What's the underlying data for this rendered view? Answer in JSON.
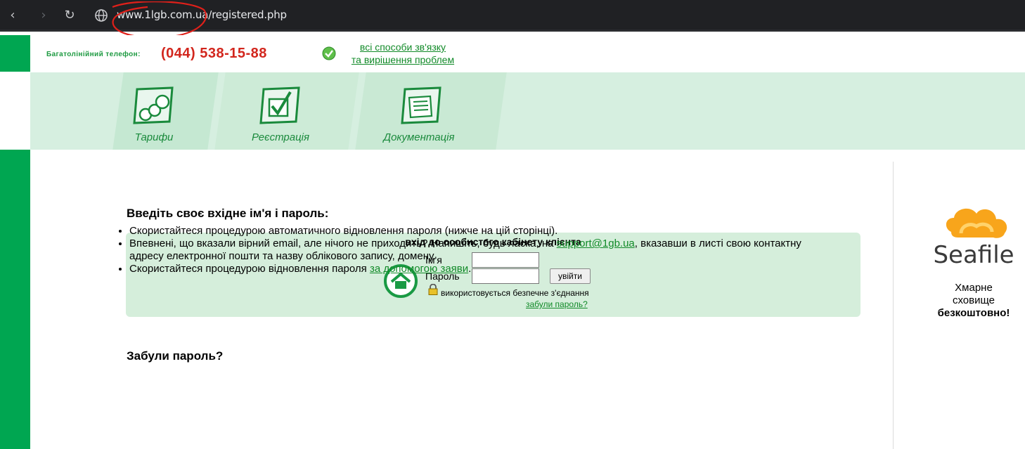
{
  "browser": {
    "url": "www.1lgb.com.ua/registered.php",
    "back_icon": "‹",
    "forward_icon": "›",
    "reload_icon": "↻"
  },
  "header": {
    "phone_label": "Багатолінійний телефон:",
    "phone_number": "(044) 538-15-88",
    "contact_line1": "всі способи зв'язку",
    "contact_line2": "та вирішення проблем"
  },
  "menu": {
    "items": [
      {
        "label": "Тарифи",
        "icon": "tariffs-coins-icon"
      },
      {
        "label": "Реєстрація",
        "icon": "registration-check-icon"
      },
      {
        "label": "Документація",
        "icon": "documentation-folder-icon"
      }
    ]
  },
  "login": {
    "title": "Введіть своє вхідне ім'я і пароль:",
    "box_title": "вхід до особистого кабінету клієнта",
    "name_label": "Ім'я",
    "password_label": "Пароль",
    "name_value": "",
    "password_value": "",
    "submit_label": "увійти",
    "secure_text": "використовується безпечне з'єднання",
    "forgot_link": "забули пароль?"
  },
  "forgot": {
    "title": "Забули пароль?",
    "tip1": "Скористайтеся процедурою автоматичного відновлення пароля (нижче на цій сторінці).",
    "tip2_before": "Впевнені, що вказали вірний email, але нічого не приходить? Напишіть, будь ласка, на ",
    "tip2_link": "support@1gb.ua",
    "tip2_after": ", вказавши в листі свою контактну адресу електронної пошти та назву облікового запису, домену.",
    "tip3_before": "Скористайтеся процедурою відновлення пароля ",
    "tip3_link": "за допомогою заяви",
    "tip3_after": "."
  },
  "sidebar_ad": {
    "brand": "Seafile",
    "line1": "Хмарне",
    "line2": "сховище",
    "line3": "безкоштовно!"
  },
  "colors": {
    "brand_green": "#00a651",
    "link_green": "#118a28",
    "phone_red": "#d2261d",
    "box_bg": "#d5eedb"
  }
}
